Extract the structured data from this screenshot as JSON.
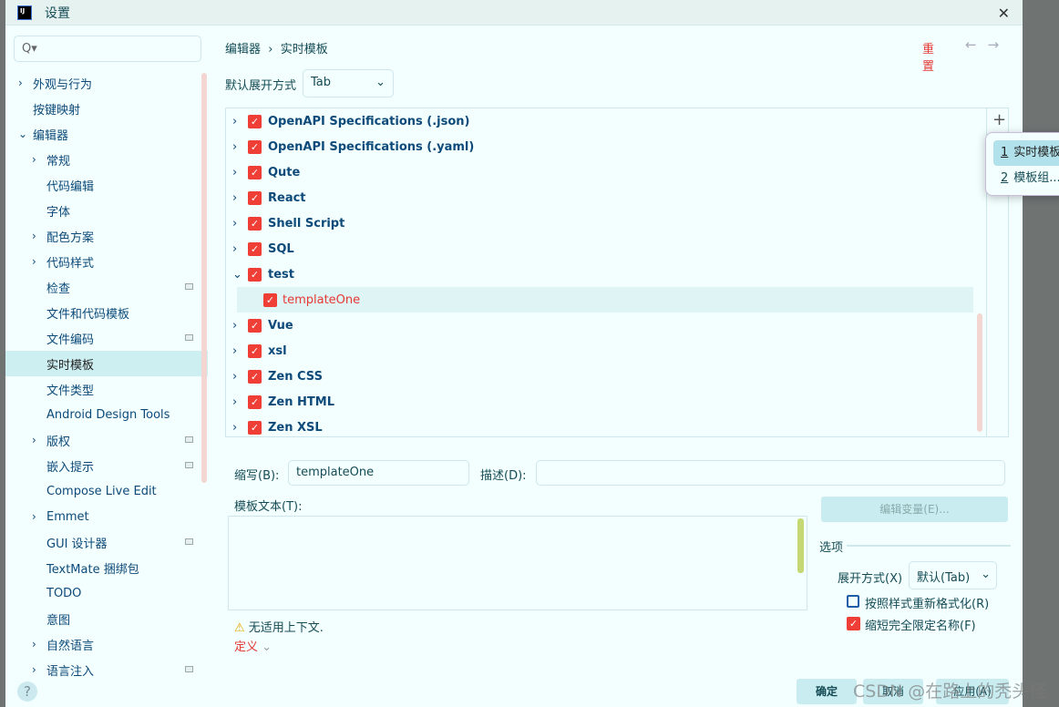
{
  "window": {
    "title": "设置",
    "close": "✕",
    "logo": "IJ"
  },
  "search": {
    "placeholder": "Q▾"
  },
  "sidebar": {
    "items": [
      {
        "label": "外观与行为",
        "arrow": "›",
        "level": 0
      },
      {
        "label": "按键映射",
        "level": 0
      },
      {
        "label": "编辑器",
        "arrow": "⌄",
        "level": 0
      },
      {
        "label": "常规",
        "arrow": "›",
        "level": 1
      },
      {
        "label": "代码编辑",
        "level": 1
      },
      {
        "label": "字体",
        "level": 1
      },
      {
        "label": "配色方案",
        "arrow": "›",
        "level": 1
      },
      {
        "label": "代码样式",
        "arrow": "›",
        "level": 1
      },
      {
        "label": "检查",
        "level": 1,
        "badge": true
      },
      {
        "label": "文件和代码模板",
        "level": 1
      },
      {
        "label": "文件编码",
        "level": 1,
        "badge": true
      },
      {
        "label": "实时模板",
        "level": 1,
        "selected": true
      },
      {
        "label": "文件类型",
        "level": 1
      },
      {
        "label": "Android Design Tools",
        "level": 1
      },
      {
        "label": "版权",
        "arrow": "›",
        "level": 1,
        "badge": true
      },
      {
        "label": "嵌入提示",
        "level": 1,
        "badge": true
      },
      {
        "label": "Compose Live Edit",
        "level": 1
      },
      {
        "label": "Emmet",
        "arrow": "›",
        "level": 1
      },
      {
        "label": "GUI 设计器",
        "level": 1,
        "badge": true
      },
      {
        "label": "TextMate 捆绑包",
        "level": 1
      },
      {
        "label": "TODO",
        "level": 1
      },
      {
        "label": "意图",
        "level": 1
      },
      {
        "label": "自然语言",
        "arrow": "›",
        "level": 1
      },
      {
        "label": "语言注入",
        "arrow": "›",
        "level": 1,
        "badge": true
      }
    ],
    "help": "?"
  },
  "breadcrumb": {
    "parent": "编辑器",
    "sep": "›",
    "current": "实时模板"
  },
  "header": {
    "reset": "重置",
    "back": "←",
    "forward": "→"
  },
  "expand_default": {
    "label": "默认展开方式",
    "value": "Tab"
  },
  "templates": [
    {
      "name": "OpenAPI Specifications (.json)",
      "expanded": false,
      "checked": true
    },
    {
      "name": "OpenAPI Specifications (.yaml)",
      "expanded": false,
      "checked": true
    },
    {
      "name": "Qute",
      "expanded": false,
      "checked": true
    },
    {
      "name": "React",
      "expanded": false,
      "checked": true
    },
    {
      "name": "Shell Script",
      "expanded": false,
      "checked": true
    },
    {
      "name": "SQL",
      "expanded": false,
      "checked": true
    },
    {
      "name": "test",
      "expanded": true,
      "checked": true,
      "children": [
        {
          "name": "templateOne",
          "checked": true,
          "selected": true
        }
      ]
    },
    {
      "name": "Vue",
      "expanded": false,
      "checked": true
    },
    {
      "name": "xsl",
      "expanded": false,
      "checked": true
    },
    {
      "name": "Zen CSS",
      "expanded": false,
      "checked": true
    },
    {
      "name": "Zen HTML",
      "expanded": false,
      "checked": true
    },
    {
      "name": "Zen XSL",
      "expanded": false,
      "checked": true
    }
  ],
  "add_menu": {
    "add_icon": "+",
    "items": [
      {
        "key": "1",
        "label": "实时模板"
      },
      {
        "key": "2",
        "label": "模板组..."
      }
    ]
  },
  "form": {
    "abbr_label": "缩写(B):",
    "abbr_value": "templateOne",
    "desc_label": "描述(D):",
    "desc_value": "",
    "text_label": "模板文本(T):",
    "text_value": "",
    "edit_vars": "编辑变量(E)...",
    "warning": "无适用上下文.",
    "define": "定义",
    "options_title": "选项",
    "expand_label": "展开方式(X)",
    "expand_value": "默认(Tab)",
    "reformat": {
      "label": "按照样式重新格式化(R)",
      "checked": false
    },
    "shorten": {
      "label": "缩短完全限定名称(F)",
      "checked": true
    }
  },
  "footer": {
    "ok": "确定",
    "cancel": "取消",
    "apply": "应用(A)"
  },
  "watermark": "CSDN @在路上的秃头怪",
  "colors": {
    "accent_red": "#e53935",
    "selected_bg": "#cdeff2",
    "text": "#0d4a7a",
    "bg": "#f2fffe"
  }
}
